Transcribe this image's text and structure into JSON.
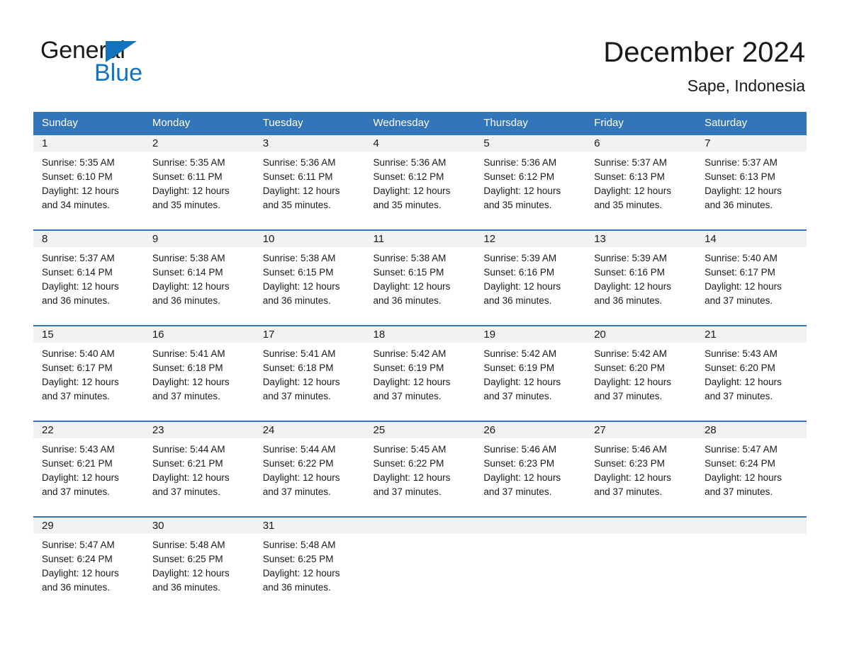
{
  "brand": {
    "name_part1": "General",
    "name_part2": "Blue",
    "accent_color": "#1273bd"
  },
  "header": {
    "title": "December 2024",
    "subtitle": "Sape, Indonesia"
  },
  "theme": {
    "header_bg": "#3275b8",
    "daynum_bg": "#f2f2f2",
    "row_border": "#3275b8"
  },
  "weekday_headers": [
    "Sunday",
    "Monday",
    "Tuesday",
    "Wednesday",
    "Thursday",
    "Friday",
    "Saturday"
  ],
  "weeks": [
    [
      {
        "day": "1",
        "sunrise": "Sunrise: 5:35 AM",
        "sunset": "Sunset: 6:10 PM",
        "daylight1": "Daylight: 12 hours",
        "daylight2": "and 34 minutes."
      },
      {
        "day": "2",
        "sunrise": "Sunrise: 5:35 AM",
        "sunset": "Sunset: 6:11 PM",
        "daylight1": "Daylight: 12 hours",
        "daylight2": "and 35 minutes."
      },
      {
        "day": "3",
        "sunrise": "Sunrise: 5:36 AM",
        "sunset": "Sunset: 6:11 PM",
        "daylight1": "Daylight: 12 hours",
        "daylight2": "and 35 minutes."
      },
      {
        "day": "4",
        "sunrise": "Sunrise: 5:36 AM",
        "sunset": "Sunset: 6:12 PM",
        "daylight1": "Daylight: 12 hours",
        "daylight2": "and 35 minutes."
      },
      {
        "day": "5",
        "sunrise": "Sunrise: 5:36 AM",
        "sunset": "Sunset: 6:12 PM",
        "daylight1": "Daylight: 12 hours",
        "daylight2": "and 35 minutes."
      },
      {
        "day": "6",
        "sunrise": "Sunrise: 5:37 AM",
        "sunset": "Sunset: 6:13 PM",
        "daylight1": "Daylight: 12 hours",
        "daylight2": "and 35 minutes."
      },
      {
        "day": "7",
        "sunrise": "Sunrise: 5:37 AM",
        "sunset": "Sunset: 6:13 PM",
        "daylight1": "Daylight: 12 hours",
        "daylight2": "and 36 minutes."
      }
    ],
    [
      {
        "day": "8",
        "sunrise": "Sunrise: 5:37 AM",
        "sunset": "Sunset: 6:14 PM",
        "daylight1": "Daylight: 12 hours",
        "daylight2": "and 36 minutes."
      },
      {
        "day": "9",
        "sunrise": "Sunrise: 5:38 AM",
        "sunset": "Sunset: 6:14 PM",
        "daylight1": "Daylight: 12 hours",
        "daylight2": "and 36 minutes."
      },
      {
        "day": "10",
        "sunrise": "Sunrise: 5:38 AM",
        "sunset": "Sunset: 6:15 PM",
        "daylight1": "Daylight: 12 hours",
        "daylight2": "and 36 minutes."
      },
      {
        "day": "11",
        "sunrise": "Sunrise: 5:38 AM",
        "sunset": "Sunset: 6:15 PM",
        "daylight1": "Daylight: 12 hours",
        "daylight2": "and 36 minutes."
      },
      {
        "day": "12",
        "sunrise": "Sunrise: 5:39 AM",
        "sunset": "Sunset: 6:16 PM",
        "daylight1": "Daylight: 12 hours",
        "daylight2": "and 36 minutes."
      },
      {
        "day": "13",
        "sunrise": "Sunrise: 5:39 AM",
        "sunset": "Sunset: 6:16 PM",
        "daylight1": "Daylight: 12 hours",
        "daylight2": "and 36 minutes."
      },
      {
        "day": "14",
        "sunrise": "Sunrise: 5:40 AM",
        "sunset": "Sunset: 6:17 PM",
        "daylight1": "Daylight: 12 hours",
        "daylight2": "and 37 minutes."
      }
    ],
    [
      {
        "day": "15",
        "sunrise": "Sunrise: 5:40 AM",
        "sunset": "Sunset: 6:17 PM",
        "daylight1": "Daylight: 12 hours",
        "daylight2": "and 37 minutes."
      },
      {
        "day": "16",
        "sunrise": "Sunrise: 5:41 AM",
        "sunset": "Sunset: 6:18 PM",
        "daylight1": "Daylight: 12 hours",
        "daylight2": "and 37 minutes."
      },
      {
        "day": "17",
        "sunrise": "Sunrise: 5:41 AM",
        "sunset": "Sunset: 6:18 PM",
        "daylight1": "Daylight: 12 hours",
        "daylight2": "and 37 minutes."
      },
      {
        "day": "18",
        "sunrise": "Sunrise: 5:42 AM",
        "sunset": "Sunset: 6:19 PM",
        "daylight1": "Daylight: 12 hours",
        "daylight2": "and 37 minutes."
      },
      {
        "day": "19",
        "sunrise": "Sunrise: 5:42 AM",
        "sunset": "Sunset: 6:19 PM",
        "daylight1": "Daylight: 12 hours",
        "daylight2": "and 37 minutes."
      },
      {
        "day": "20",
        "sunrise": "Sunrise: 5:42 AM",
        "sunset": "Sunset: 6:20 PM",
        "daylight1": "Daylight: 12 hours",
        "daylight2": "and 37 minutes."
      },
      {
        "day": "21",
        "sunrise": "Sunrise: 5:43 AM",
        "sunset": "Sunset: 6:20 PM",
        "daylight1": "Daylight: 12 hours",
        "daylight2": "and 37 minutes."
      }
    ],
    [
      {
        "day": "22",
        "sunrise": "Sunrise: 5:43 AM",
        "sunset": "Sunset: 6:21 PM",
        "daylight1": "Daylight: 12 hours",
        "daylight2": "and 37 minutes."
      },
      {
        "day": "23",
        "sunrise": "Sunrise: 5:44 AM",
        "sunset": "Sunset: 6:21 PM",
        "daylight1": "Daylight: 12 hours",
        "daylight2": "and 37 minutes."
      },
      {
        "day": "24",
        "sunrise": "Sunrise: 5:44 AM",
        "sunset": "Sunset: 6:22 PM",
        "daylight1": "Daylight: 12 hours",
        "daylight2": "and 37 minutes."
      },
      {
        "day": "25",
        "sunrise": "Sunrise: 5:45 AM",
        "sunset": "Sunset: 6:22 PM",
        "daylight1": "Daylight: 12 hours",
        "daylight2": "and 37 minutes."
      },
      {
        "day": "26",
        "sunrise": "Sunrise: 5:46 AM",
        "sunset": "Sunset: 6:23 PM",
        "daylight1": "Daylight: 12 hours",
        "daylight2": "and 37 minutes."
      },
      {
        "day": "27",
        "sunrise": "Sunrise: 5:46 AM",
        "sunset": "Sunset: 6:23 PM",
        "daylight1": "Daylight: 12 hours",
        "daylight2": "and 37 minutes."
      },
      {
        "day": "28",
        "sunrise": "Sunrise: 5:47 AM",
        "sunset": "Sunset: 6:24 PM",
        "daylight1": "Daylight: 12 hours",
        "daylight2": "and 37 minutes."
      }
    ],
    [
      {
        "day": "29",
        "sunrise": "Sunrise: 5:47 AM",
        "sunset": "Sunset: 6:24 PM",
        "daylight1": "Daylight: 12 hours",
        "daylight2": "and 36 minutes."
      },
      {
        "day": "30",
        "sunrise": "Sunrise: 5:48 AM",
        "sunset": "Sunset: 6:25 PM",
        "daylight1": "Daylight: 12 hours",
        "daylight2": "and 36 minutes."
      },
      {
        "day": "31",
        "sunrise": "Sunrise: 5:48 AM",
        "sunset": "Sunset: 6:25 PM",
        "daylight1": "Daylight: 12 hours",
        "daylight2": "and 36 minutes."
      },
      {
        "day": "",
        "sunrise": "",
        "sunset": "",
        "daylight1": "",
        "daylight2": ""
      },
      {
        "day": "",
        "sunrise": "",
        "sunset": "",
        "daylight1": "",
        "daylight2": ""
      },
      {
        "day": "",
        "sunrise": "",
        "sunset": "",
        "daylight1": "",
        "daylight2": ""
      },
      {
        "day": "",
        "sunrise": "",
        "sunset": "",
        "daylight1": "",
        "daylight2": ""
      }
    ]
  ]
}
